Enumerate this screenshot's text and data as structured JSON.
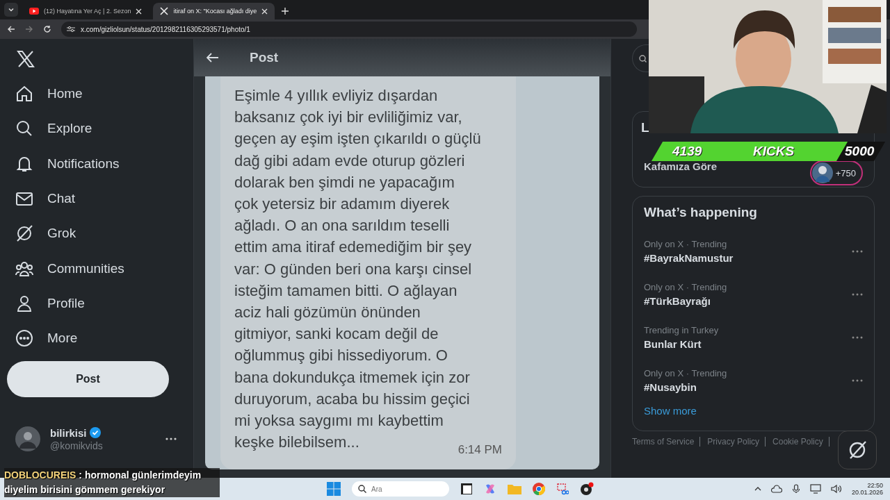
{
  "browser": {
    "tabs": [
      {
        "title": "(12) Hayatına Yer Aç | 2. Sezon",
        "kind": "video",
        "selected": false
      },
      {
        "title": "itiraf on X: \"Kocası ağladı diye",
        "kind": "x",
        "selected": true
      }
    ],
    "url": "x.com/gizliolsun/status/2012982116305293571/photo/1"
  },
  "nav": {
    "items": [
      {
        "label": "Home"
      },
      {
        "label": "Explore"
      },
      {
        "label": "Notifications"
      },
      {
        "label": "Chat"
      },
      {
        "label": "Grok"
      },
      {
        "label": "Communities"
      },
      {
        "label": "Profile"
      },
      {
        "label": "More"
      }
    ],
    "post_button": "Post",
    "account": {
      "name": "bilirkisi",
      "handle": "@komikvids",
      "verified": true
    }
  },
  "post": {
    "title": "Post",
    "image_lines": [
      "Eşimle 4 yıllık evliyiz dışardan",
      "baksanız çok iyi bir evliliğimiz var,",
      "geçen ay eşim işten çıkarıldı o güçlü",
      "dağ gibi adam evde oturup gözleri",
      "dolarak ben şimdi ne yapacağım",
      "çok yetersiz bir adamım diyerek",
      "ağladı. O an ona sarıldım teselli",
      "ettim ama itiraf edemediğim bir şey",
      "var: O günden beri ona karşı cinsel",
      "isteğim tamamen bitti. O ağlayan",
      "aciz hali gözümün önünden",
      "gitmiyor, sanki kocam değil de",
      "oğlummuş gibi hissediyorum. O",
      "bana dokundukça itmemek için zor",
      "duruyorum, acaba bu hissim geçici",
      "mi yoksa saygımı mı kaybettim",
      "keşke bilebilsem..."
    ],
    "time": "6:14 PM"
  },
  "sidebar": {
    "live": {
      "heading": "L",
      "title": "Kafamıza Göre",
      "count": "+750"
    },
    "trends": {
      "title": "What’s happening",
      "items": [
        {
          "context": "Only on X · Trending",
          "topic": "#BayrakNamustur"
        },
        {
          "context": "Only on X · Trending",
          "topic": "#TürkBayrağı"
        },
        {
          "context": "Trending in Turkey",
          "topic": "Bunlar Kürt"
        },
        {
          "context": "Only on X · Trending",
          "topic": "#Nusaybin"
        }
      ],
      "show_more": "Show more"
    },
    "footer": [
      "Terms of Service",
      "Privacy Policy",
      "Cookie Policy"
    ]
  },
  "overlay": {
    "kicks": {
      "current": "4139",
      "label": "KICKS",
      "goal": "5000",
      "level": 0.83
    },
    "chat": {
      "user": "DOBLOCUREIS",
      "message": ": hormonal günlerimdeyim diyelim birisini gömmem gerekiyor"
    }
  },
  "taskbar": {
    "search_placeholder": "Ara",
    "time": "22:50",
    "date": "20.01.2026"
  }
}
